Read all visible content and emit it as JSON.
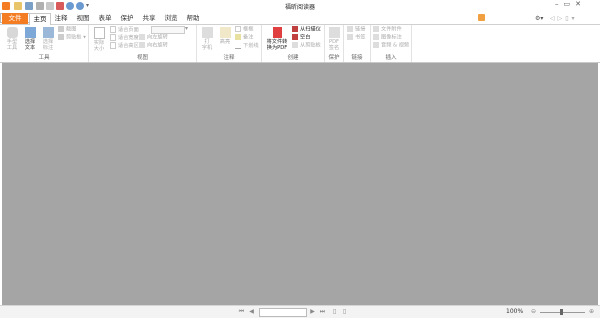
{
  "app": {
    "title": "福昕阅读器"
  },
  "tabs": [
    "文件",
    "主页",
    "注释",
    "视图",
    "表单",
    "保护",
    "共享",
    "浏览",
    "帮助"
  ],
  "search": {
    "placeholder": "查找"
  },
  "ribbon": {
    "tools": {
      "label": "工具",
      "hand": "手型\n工具",
      "select_text": "选择\n文本",
      "select_annot": "选择\n标注",
      "screenshot": "截图",
      "clipboard": "剪贴板"
    },
    "view": {
      "label": "视图",
      "actual_size": "实际\n大小",
      "fit_page": "适合页面",
      "fit_width": "适合宽度",
      "fit_visible": "适合高区",
      "rotate_left": "向左旋转",
      "rotate_right": "向右旋转"
    },
    "comment": {
      "label": "注释",
      "typewriter": "打\n字机",
      "highlight": "高亮",
      "textbox": "框框",
      "note": "备注",
      "underline": "下划线"
    },
    "create": {
      "label": "创建",
      "convert": "将文件转\n换为PDF",
      "from_scanner": "从扫描仪",
      "blank": "空白",
      "from_clipboard": "从剪贴板"
    },
    "protect": {
      "label": "保护",
      "pdf_sign": "PDF\n签名"
    },
    "link": {
      "label": "链接",
      "link": "链接",
      "bookmark": "书签"
    },
    "insert": {
      "label": "插入",
      "file_attach": "文件附件",
      "image_annot": "图像标注",
      "audio_video": "音频 & 视频"
    }
  },
  "status": {
    "zoom": "100%"
  }
}
